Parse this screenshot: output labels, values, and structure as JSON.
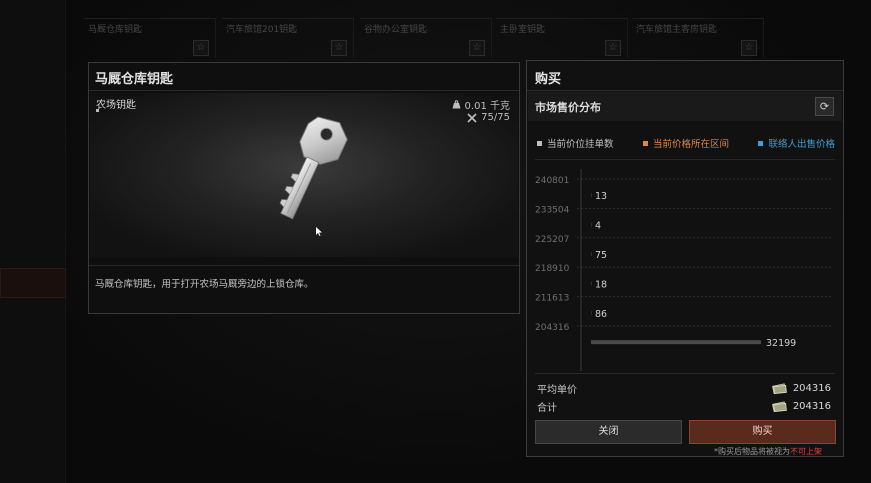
{
  "background": {
    "cards": [
      {
        "name": "马厩仓库钥匙"
      },
      {
        "name": "汽车旅馆201钥匙"
      },
      {
        "name": "谷物办公室钥匙"
      },
      {
        "name": "主卧室钥匙"
      },
      {
        "name": "汽车旅馆主客房钥匙"
      }
    ]
  },
  "item": {
    "title": "马厩仓库钥匙",
    "category": "农场钥匙",
    "weight": "0.01 千克",
    "durability": "75/75",
    "description": "马厩仓库钥匙，用于打开农场马厩旁边的上锁仓库。",
    "icons": {
      "weight": "weight-icon",
      "durability": "tools-icon"
    }
  },
  "buy": {
    "title": "购买",
    "distribution_title": "市场售价分布",
    "legend": [
      {
        "label": "当前价位挂单数",
        "color": "#bfbfbf"
      },
      {
        "label": "当前价格所在区间",
        "color": "#d9884a"
      },
      {
        "label": "联络人出售价格",
        "color": "#3c9fd8"
      }
    ],
    "avg_price_label": "平均单价",
    "avg_price_value": "204316",
    "total_label": "合计",
    "total_value": "204316",
    "close_label": "关闭",
    "buy_label": "购买",
    "note_prefix": "*购买后物品将被视为",
    "note_highlight": "不可上架"
  },
  "chart_data": {
    "type": "bar",
    "orientation": "horizontal",
    "categories": [
      "240801",
      "233504",
      "225207",
      "218910",
      "211613",
      "204316"
    ],
    "values": [
      13,
      4,
      75,
      18,
      86,
      32199
    ],
    "grid": true
  }
}
